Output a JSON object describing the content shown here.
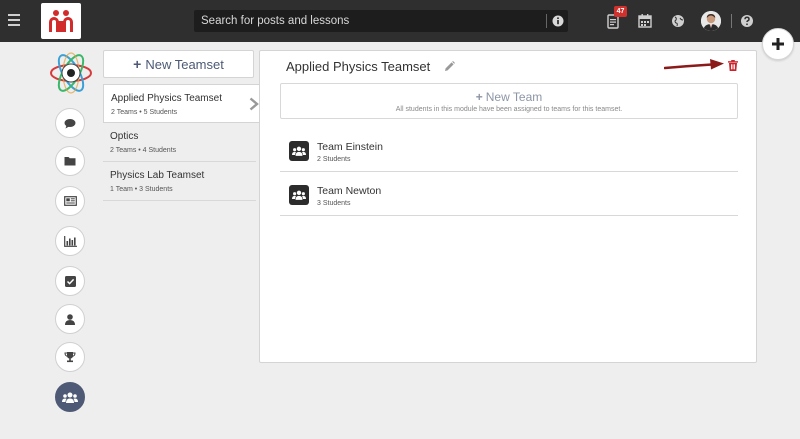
{
  "search": {
    "placeholder": "Search for posts and lessons"
  },
  "header": {
    "notification_count": "47"
  },
  "teamsets": {
    "new_label": "New Teamset",
    "items": [
      {
        "name": "Applied Physics Teamset",
        "meta": "2 Teams • 5 Students"
      },
      {
        "name": "Optics",
        "meta": "2 Teams • 4 Students"
      },
      {
        "name": "Physics Lab Teamset",
        "meta": "1 Team • 3 Students"
      }
    ]
  },
  "panel": {
    "title": "Applied Physics Teamset",
    "new_team_label": "New Team",
    "new_team_note": "All students in this module have been assigned to teams for this teamset.",
    "teams": [
      {
        "name": "Team Einstein",
        "meta": "2 Students"
      },
      {
        "name": "Team Newton",
        "meta": "3 Students"
      }
    ]
  },
  "colors": {
    "topbar": "#2f2f2f",
    "accent": "#4c5a75",
    "logo_red": "#d22b2b",
    "delete_red": "#c9232b",
    "arrow": "#8b1a1a"
  },
  "icons": {
    "topbar": [
      "hamburger-icon",
      "info-icon",
      "notes-icon",
      "calendar-icon",
      "globe-icon",
      "help-icon"
    ],
    "rail": [
      "chat-icon",
      "folder-icon",
      "newspaper-icon",
      "bar-chart-icon",
      "checkbox-icon",
      "user-icon",
      "trophy-icon",
      "users-icon"
    ]
  }
}
